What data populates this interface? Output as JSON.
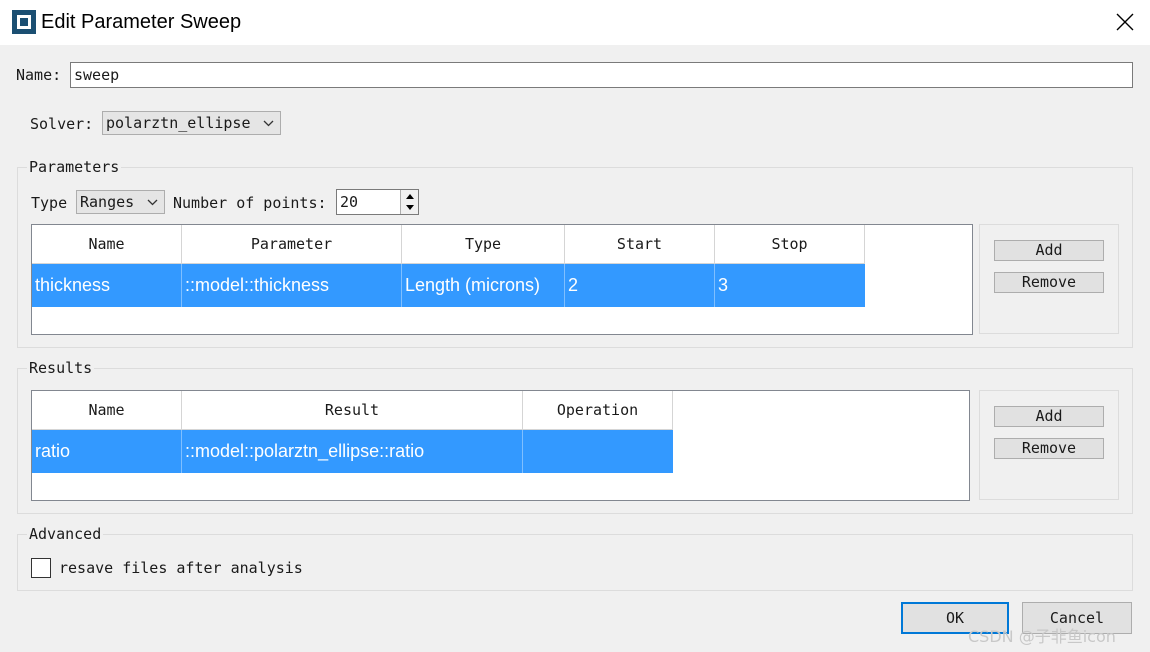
{
  "window": {
    "title": "Edit Parameter Sweep",
    "close_symbol": "close-icon"
  },
  "name_field": {
    "label": "Name:",
    "value": "sweep"
  },
  "solver_field": {
    "label": "Solver:",
    "value": "polarztn_ellipse"
  },
  "parameters": {
    "group_title": "Parameters",
    "type_label": "Type",
    "type_value": "Ranges",
    "points_label": "Number of points:",
    "points_value": "20",
    "columns": [
      "Name",
      "Parameter",
      "Type",
      "Start",
      "Stop"
    ],
    "rows": [
      {
        "name": "thickness",
        "parameter": "::model::thickness",
        "type": "Length (microns)",
        "start": "2",
        "stop": "3"
      }
    ],
    "add_label": "Add",
    "remove_label": "Remove"
  },
  "results": {
    "group_title": "Results",
    "columns": [
      "Name",
      "Result",
      "Operation"
    ],
    "rows": [
      {
        "name": "ratio",
        "result": "::model::polarztn_ellipse::ratio",
        "operation": ""
      }
    ],
    "add_label": "Add",
    "remove_label": "Remove"
  },
  "advanced": {
    "group_title": "Advanced",
    "resave_label": "resave files after analysis",
    "resave_checked": false
  },
  "footer": {
    "ok_label": "OK",
    "cancel_label": "Cancel"
  },
  "watermark": "CSDN @子非鱼icon",
  "colors": {
    "selection": "#3399ff",
    "focus_border": "#0078d7",
    "app_icon": "#1b4f72"
  }
}
